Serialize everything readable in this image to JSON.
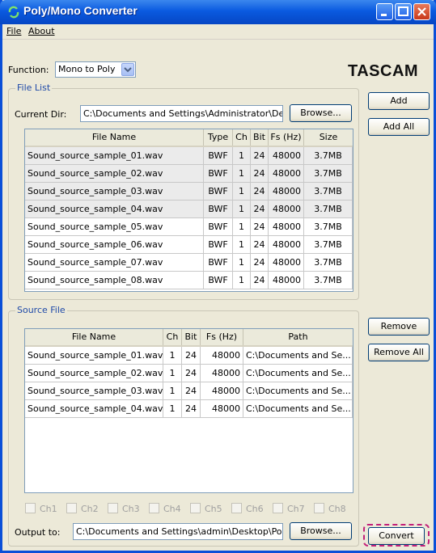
{
  "title": "Poly/Mono Converter",
  "menu": [
    {
      "label": "File"
    },
    {
      "label": "About"
    }
  ],
  "function": {
    "label": "Function:",
    "value": "Mono to Poly"
  },
  "logo": "TASCAM",
  "file_list": {
    "group_title": "File List",
    "dir_label": "Current Dir:",
    "dir_value": "C:\\Documents and Settings\\Administrator\\Deskt",
    "browse": "Browse...",
    "columns": [
      "File Name",
      "Type",
      "Ch",
      "Bit",
      "Fs (Hz)",
      "Size"
    ],
    "rows": [
      {
        "name": "Sound_source_sample_01.wav",
        "type": "BWF",
        "ch": "1",
        "bit": "24",
        "fs": "48000",
        "size": "3.7MB",
        "selected": true
      },
      {
        "name": "Sound_source_sample_02.wav",
        "type": "BWF",
        "ch": "1",
        "bit": "24",
        "fs": "48000",
        "size": "3.7MB",
        "selected": true
      },
      {
        "name": "Sound_source_sample_03.wav",
        "type": "BWF",
        "ch": "1",
        "bit": "24",
        "fs": "48000",
        "size": "3.7MB",
        "selected": true
      },
      {
        "name": "Sound_source_sample_04.wav",
        "type": "BWF",
        "ch": "1",
        "bit": "24",
        "fs": "48000",
        "size": "3.7MB",
        "selected": true
      },
      {
        "name": "Sound_source_sample_05.wav",
        "type": "BWF",
        "ch": "1",
        "bit": "24",
        "fs": "48000",
        "size": "3.7MB",
        "selected": false
      },
      {
        "name": "Sound_source_sample_06.wav",
        "type": "BWF",
        "ch": "1",
        "bit": "24",
        "fs": "48000",
        "size": "3.7MB",
        "selected": false
      },
      {
        "name": "Sound_source_sample_07.wav",
        "type": "BWF",
        "ch": "1",
        "bit": "24",
        "fs": "48000",
        "size": "3.7MB",
        "selected": false
      },
      {
        "name": "Sound_source_sample_08.wav",
        "type": "BWF",
        "ch": "1",
        "bit": "24",
        "fs": "48000",
        "size": "3.7MB",
        "selected": false
      }
    ]
  },
  "side_buttons": {
    "add": "Add",
    "add_all": "Add All",
    "remove": "Remove",
    "remove_all": "Remove All"
  },
  "source": {
    "group_title": "Source File",
    "columns": [
      "File Name",
      "Ch",
      "Bit",
      "Fs (Hz)",
      "Path"
    ],
    "rows": [
      {
        "name": "Sound_source_sample_01.wav",
        "ch": "1",
        "bit": "24",
        "fs": "48000",
        "path": "C:\\Documents and Se..."
      },
      {
        "name": "Sound_source_sample_02.wav",
        "ch": "1",
        "bit": "24",
        "fs": "48000",
        "path": "C:\\Documents and Se..."
      },
      {
        "name": "Sound_source_sample_03.wav",
        "ch": "1",
        "bit": "24",
        "fs": "48000",
        "path": "C:\\Documents and Se..."
      },
      {
        "name": "Sound_source_sample_04.wav",
        "ch": "1",
        "bit": "24",
        "fs": "48000",
        "path": "C:\\Documents and Se..."
      }
    ],
    "channels": [
      "Ch1",
      "Ch2",
      "Ch3",
      "Ch4",
      "Ch5",
      "Ch6",
      "Ch7",
      "Ch8"
    ],
    "output_label": "Output to:",
    "output_value": "C:\\Documents and Settings\\admin\\Desktop\\Poly",
    "browse": "Browse..."
  },
  "convert": "Convert",
  "colors": {
    "titlebar": "#0a5ae0",
    "highlight": "#c2207a",
    "group_title": "#1f4aa8"
  }
}
